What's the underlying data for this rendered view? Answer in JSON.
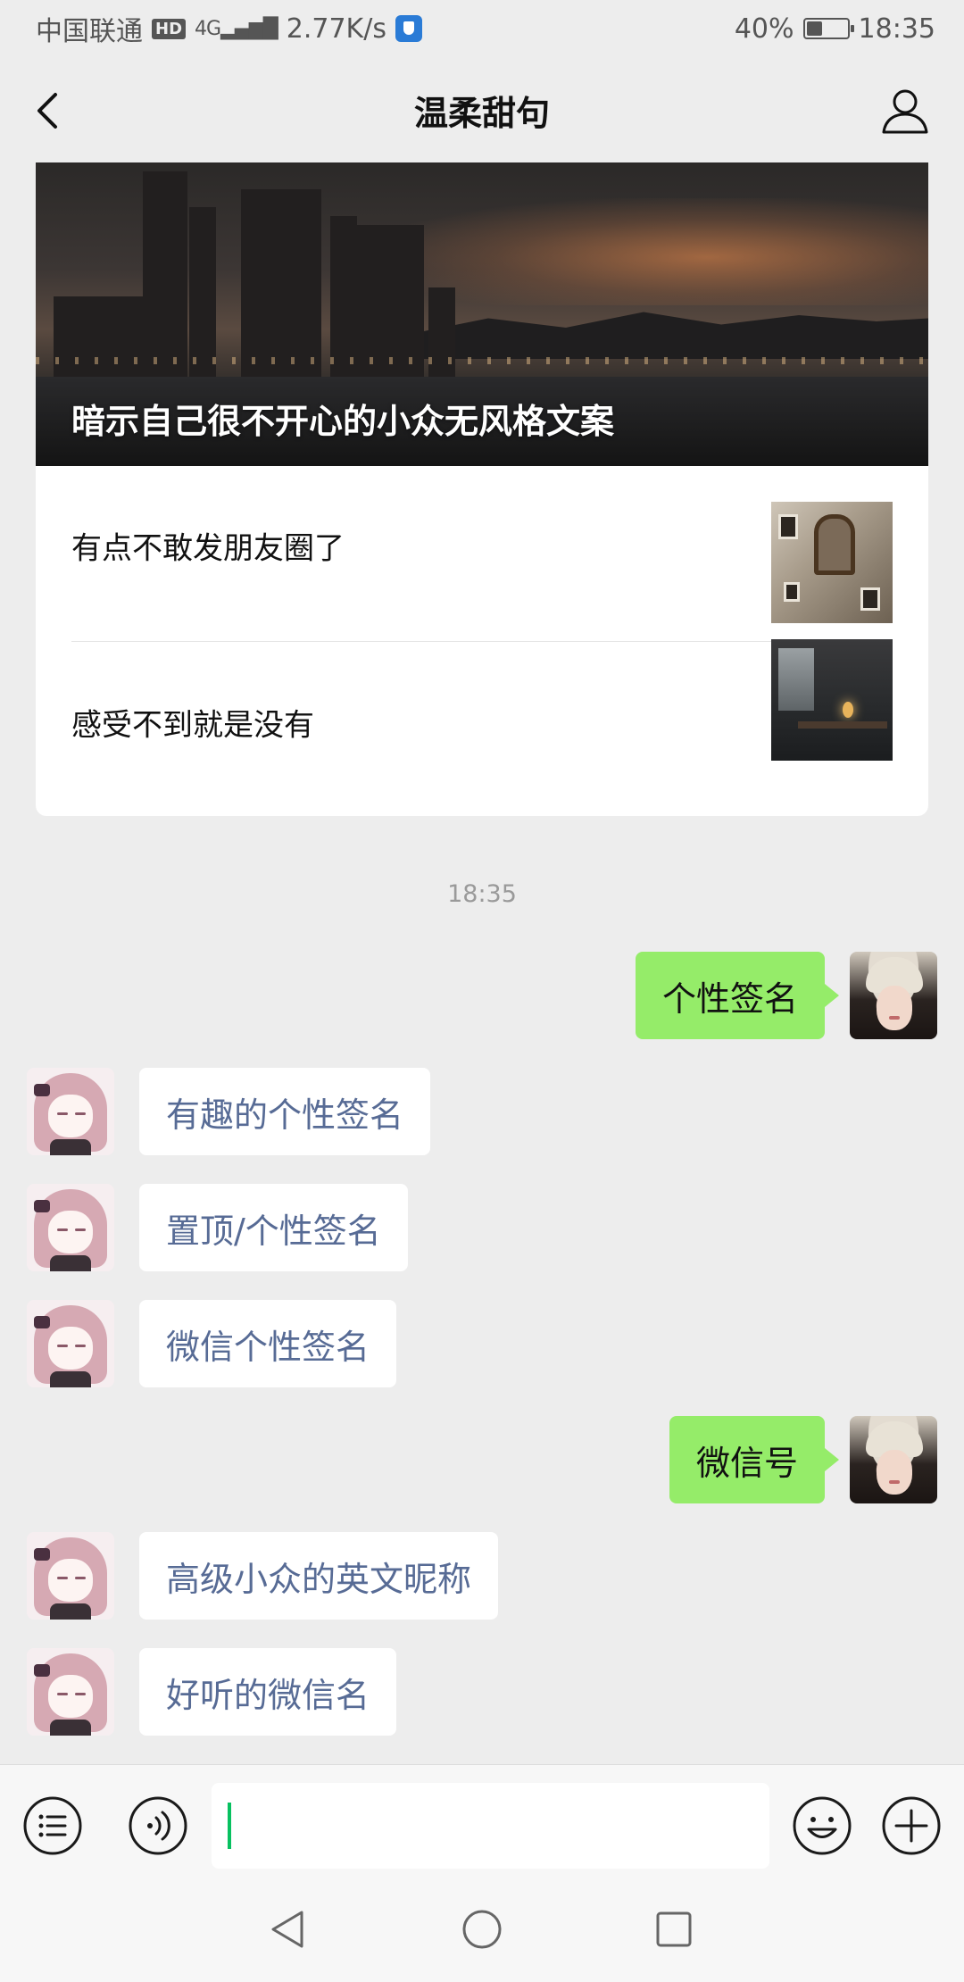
{
  "status_bar": {
    "carrier": "中国联通",
    "hd_badge": "HD",
    "network": "4G",
    "speed": "2.77K/s",
    "battery_percent_text": "40%",
    "battery_level": 0.4,
    "time": "18:35"
  },
  "nav": {
    "title": "温柔甜句",
    "back_icon": "chevron-left-icon",
    "profile_icon": "person-outline-icon"
  },
  "article_card": {
    "cover_title": "暗示自己很不开心的小众无风格文案",
    "items": [
      {
        "title": "有点不敢发朋友圈了"
      },
      {
        "title": "感受不到就是没有"
      }
    ]
  },
  "chat": {
    "timestamp": "18:35",
    "messages": [
      {
        "side": "out",
        "text": "个性签名"
      },
      {
        "side": "in",
        "text": "有趣的个性签名"
      },
      {
        "side": "in",
        "text": "置顶/个性签名"
      },
      {
        "side": "in",
        "text": "微信个性签名"
      },
      {
        "side": "out",
        "text": "微信号"
      },
      {
        "side": "in",
        "text": "高级小众的英文昵称"
      },
      {
        "side": "in",
        "text": "好听的微信名"
      }
    ]
  },
  "input_bar": {
    "menu_icon": "list-menu-icon",
    "voice_icon": "voice-icon",
    "emoji_icon": "emoji-icon",
    "plus_icon": "plus-icon",
    "text_value": ""
  },
  "system_nav": {
    "back_icon": "triangle-back-icon",
    "home_icon": "circle-home-icon",
    "recents_icon": "square-recents-icon"
  },
  "colors": {
    "background": "#ededed",
    "outgoing_bubble": "#95ec69",
    "incoming_link_text": "#576b95",
    "cursor": "#07c160"
  }
}
